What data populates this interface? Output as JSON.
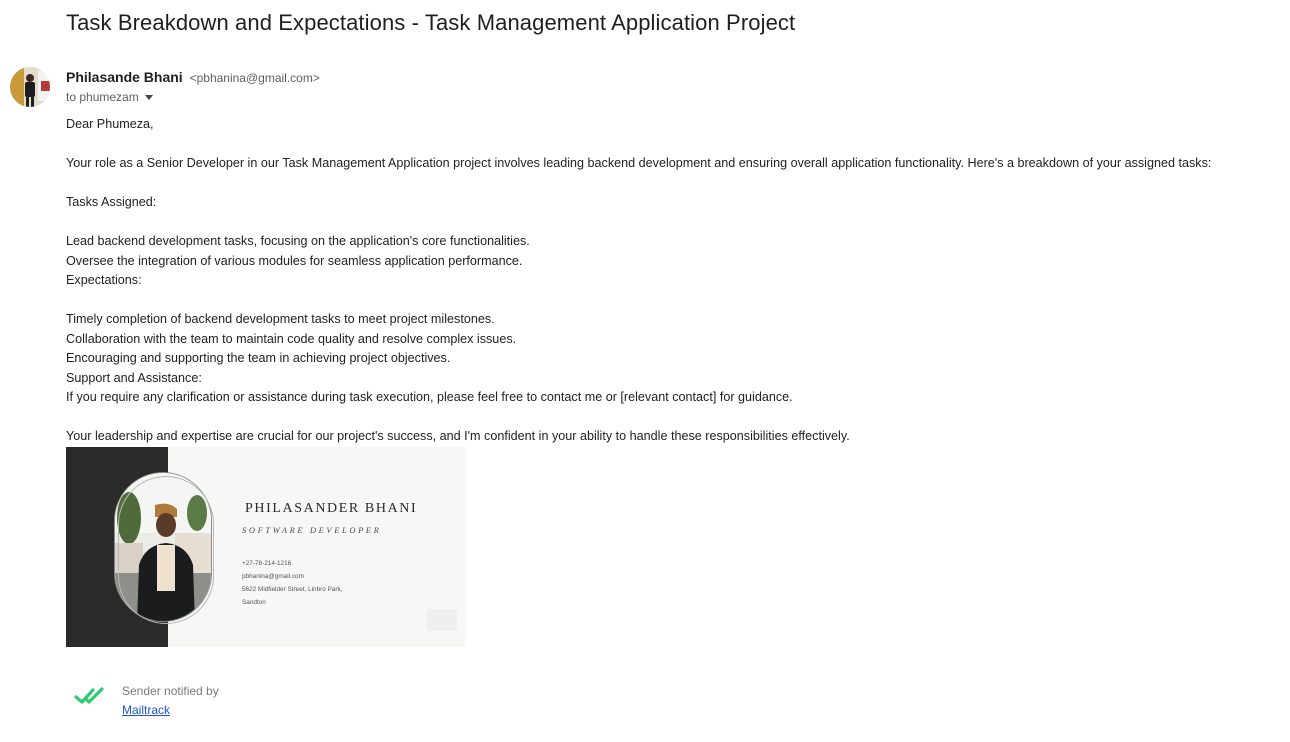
{
  "email": {
    "subject": "Task Breakdown and Expectations - Task Management Application Project",
    "sender": {
      "name": "Philasande Bhani",
      "email": "<pbhanina@gmail.com>"
    },
    "recipient_line": "to phumezam",
    "body": {
      "greeting": "Dear Phumeza,",
      "intro": "Your role as a Senior Developer in our Task Management Application project involves leading backend development and ensuring overall application functionality. Here's a breakdown of your assigned tasks:",
      "tasks_heading": "Tasks Assigned:",
      "tasks": [
        "Lead backend development tasks, focusing on the application's core functionalities.",
        "Oversee the integration of various modules for seamless application performance."
      ],
      "expectations_heading": "Expectations:",
      "expectations": [
        "Timely completion of backend development tasks to meet project milestones.",
        "Collaboration with the team to maintain code quality and resolve complex issues.",
        "Encouraging and supporting the team in achieving project objectives."
      ],
      "support_heading": "Support and Assistance:",
      "support_text": "If you require any clarification or assistance during task execution, please feel free to contact me or [relevant contact] for guidance.",
      "closing": "Your leadership and expertise are crucial for our project's success, and I'm confident in your ability to handle these responsibilities effectively."
    },
    "signature": {
      "name": "PHILASANDER BHANI",
      "title": "SOFTWARE DEVELOPER",
      "phone": "+27-78-214-1216",
      "email": "pbhanina@gmail.com",
      "address_line1": "5622 Midfielder Street, Linbro Park,",
      "address_line2": "Sandton"
    },
    "mailtrack": {
      "notice": "Sender notified by",
      "link": "Mailtrack",
      "check_color": "#2ecc71"
    }
  }
}
